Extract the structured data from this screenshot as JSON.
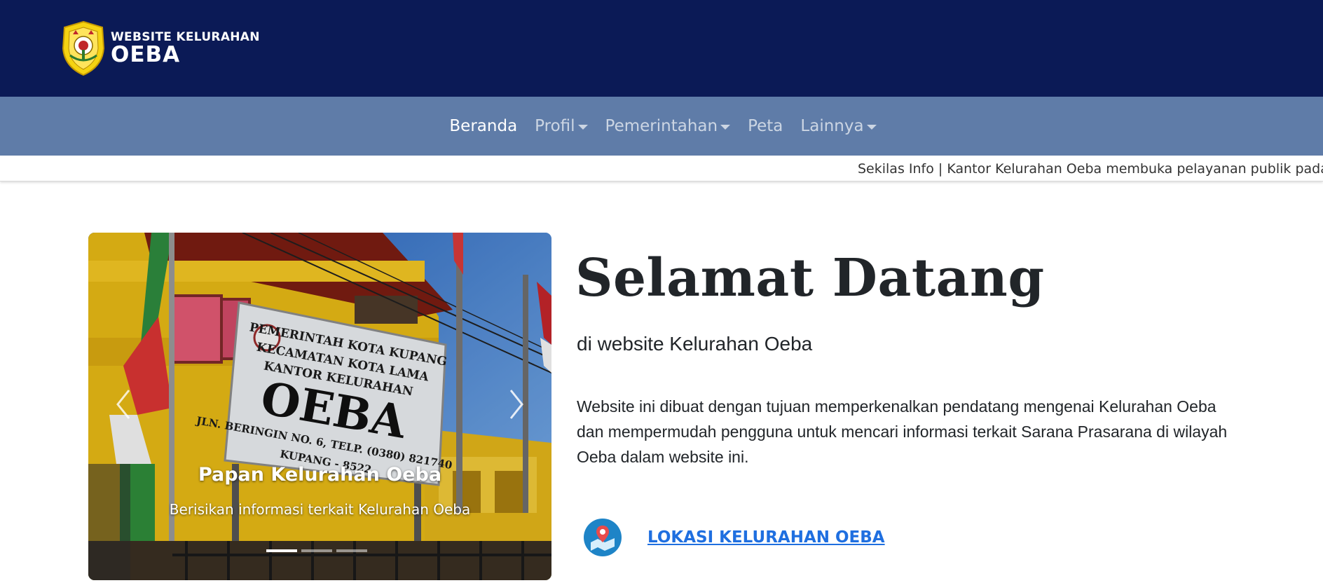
{
  "header": {
    "brand_small": "WEBSITE KELURAHAN",
    "brand_big": "OEBA",
    "logo_icon": "city-emblem-icon"
  },
  "nav": {
    "items": [
      {
        "label": "Beranda",
        "active": true,
        "dropdown": false
      },
      {
        "label": "Profil",
        "active": false,
        "dropdown": true
      },
      {
        "label": "Pemerintahan",
        "active": false,
        "dropdown": true
      },
      {
        "label": "Peta",
        "active": false,
        "dropdown": false
      },
      {
        "label": "Lainnya",
        "active": false,
        "dropdown": true
      }
    ]
  },
  "ticker": {
    "text": "Sekilas Info | Kantor Kelurahan Oeba membuka pelayanan publik pada h"
  },
  "carousel": {
    "caption_title": "Papan Kelurahan Oeba",
    "caption_text": "Berisikan informasi terkait Kelurahan Oeba",
    "slide_count": 3,
    "active_index": 0,
    "sign": {
      "line1": "PEMERINTAH KOTA KUPANG",
      "line2": "KECAMATAN KOTA LAMA",
      "line3": "KANTOR KELURAHAN",
      "line4": "OEBA",
      "line5": "JLN. BERINGIN NO. 6, TELP. (0380) 821740",
      "line6": "KUPANG - 8522"
    }
  },
  "welcome": {
    "title": "Selamat Datang",
    "subtitle": "di website Kelurahan Oeba",
    "description": "Website ini dibuat dengan tujuan memperkenalkan pendatang mengenai Kelurahan Oeba dan mempermudah pengguna untuk mencari informasi terkait Sarana Prasarana di wilayah Oeba dalam website ini."
  },
  "location": {
    "link_label": "LOKASI KELURAHAN OEBA",
    "icon": "map-pin-icon"
  },
  "colors": {
    "header_bg": "#0b1a56",
    "nav_bg": "#5f7ca8",
    "link": "#1f6fe0"
  }
}
